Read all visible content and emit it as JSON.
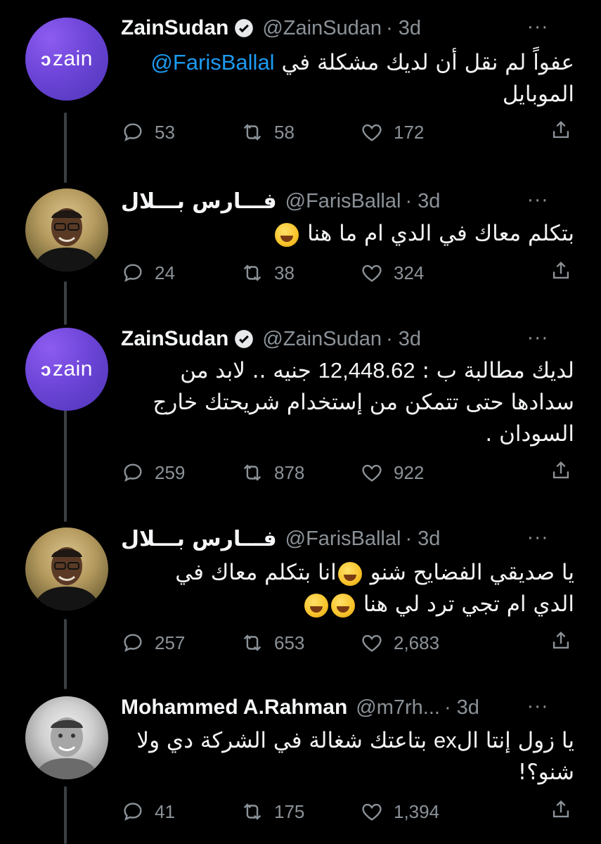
{
  "tweets": [
    {
      "name": "ZainSudan",
      "verified": true,
      "handle": "@ZainSudan",
      "time": "· 3d",
      "avatar": "zain-logo",
      "mention": "@FarisBallal",
      "text_line1": "عفواً لم نقل أن لديك مشكلة في",
      "text_line2": "الموبايل",
      "replies": "53",
      "retweets": "58",
      "likes": "172"
    },
    {
      "name": "فـــارس بـــلال",
      "verified": false,
      "handle": "@FarisBallal",
      "time": "· 3d",
      "avatar": "person-photo",
      "text_line1": "بتكلم معاك في الدي ام ما هنا",
      "emoji1": "grinning-sweat-emoji",
      "replies": "24",
      "retweets": "38",
      "likes": "324"
    },
    {
      "name": "ZainSudan",
      "verified": true,
      "handle": "@ZainSudan",
      "time": "· 3d",
      "avatar": "zain-logo",
      "text_line1_a": "لديك مطالبة ب :",
      "text_line1_num": "12,448.62",
      "text_line1_b": "جنيه .. لابد من",
      "text_line2": "سدادها حتى تتمكن من إستخدام شريحتك خارج",
      "text_line3": "السودان .",
      "replies": "259",
      "retweets": "878",
      "likes": "922"
    },
    {
      "name": "فـــارس بـــلال",
      "verified": false,
      "handle": "@FarisBallal",
      "time": "· 3d",
      "avatar": "person-photo",
      "text_line1_a": "يا صديقي الفضايح شنو",
      "text_line1_b": "انا بتكلم معاك في",
      "text_line2": "الدي ام تجي ترد لي هنا",
      "emoji": "tears-of-joy-emoji",
      "replies": "257",
      "retweets": "653",
      "likes": "2,683"
    },
    {
      "name": "Mohammed A.Rahman",
      "verified": false,
      "handle": "@m7rh...",
      "time": "· 3d",
      "avatar": "person-photo",
      "text_line1_a": "يا زول إنتا ال",
      "text_line1_ex": "ex",
      "text_line1_b": "بتاعتك شغالة في الشركة دي ولا",
      "text_line2": "شنو؟!",
      "replies": "41",
      "retweets": "175",
      "likes": "1,394"
    }
  ],
  "ui": {
    "more_icon": "···"
  },
  "colors": {
    "background": "#000000",
    "link": "#1d9bf0",
    "muted": "#8b9298",
    "zain_purple": "#6d45d8"
  }
}
